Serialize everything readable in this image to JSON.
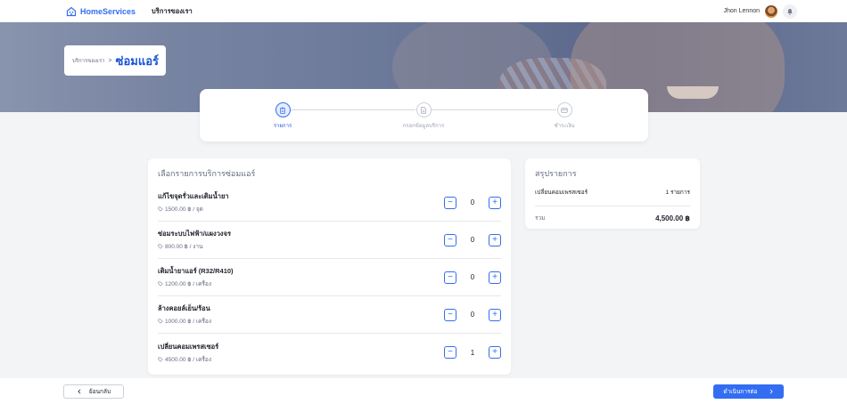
{
  "nav": {
    "brand": "HomeServices",
    "link": "บริการของเรา",
    "user_name": "Jhon Lennon"
  },
  "breadcrumb": {
    "parent": "บริการของเรา",
    "separator": ">",
    "current": "ซ่อมแอร์"
  },
  "steps": [
    {
      "label": "รายการ",
      "icon": "clipboard-icon",
      "active": true
    },
    {
      "label": "กรอกข้อมูลบริการ",
      "icon": "document-icon",
      "active": false
    },
    {
      "label": "ชำระเงิน",
      "icon": "credit-card-icon",
      "active": false
    }
  ],
  "services": {
    "title": "เลือกรายการบริการซ่อมแอร์",
    "items": [
      {
        "name": "แก้ไขจุดรั่วและเติมน้ำยา",
        "price": "1500.00 ฿ / จุด",
        "qty": "0"
      },
      {
        "name": "ซ่อมระบบไฟฟ้า/แผงวงจร",
        "price": "800.00 ฿ / งาน",
        "qty": "0"
      },
      {
        "name": "เติมน้ำยาแอร์ (R32/R410)",
        "price": "1200.00 ฿ / เครื่อง",
        "qty": "0"
      },
      {
        "name": "ล้างคอยล์เย็น/ร้อน",
        "price": "1000.00 ฿ / เครื่อง",
        "qty": "0"
      },
      {
        "name": "เปลี่ยนคอมเพรสเซอร์",
        "price": "4500.00 ฿ / เครื่อง",
        "qty": "1"
      }
    ],
    "minus": "−",
    "plus": "+"
  },
  "summary": {
    "title": "สรุปรายการ",
    "line_name": "เปลี่ยนคอมเพรสเซอร์",
    "line_qty": "1 รายการ",
    "total_label": "รวม",
    "total_value": "4,500.00 ฿"
  },
  "footer": {
    "back_label": "ย้อนกลับ",
    "next_label": "ดำเนินการต่อ"
  },
  "colors": {
    "primary": "#336df2",
    "title_blue": "#1852d6"
  }
}
